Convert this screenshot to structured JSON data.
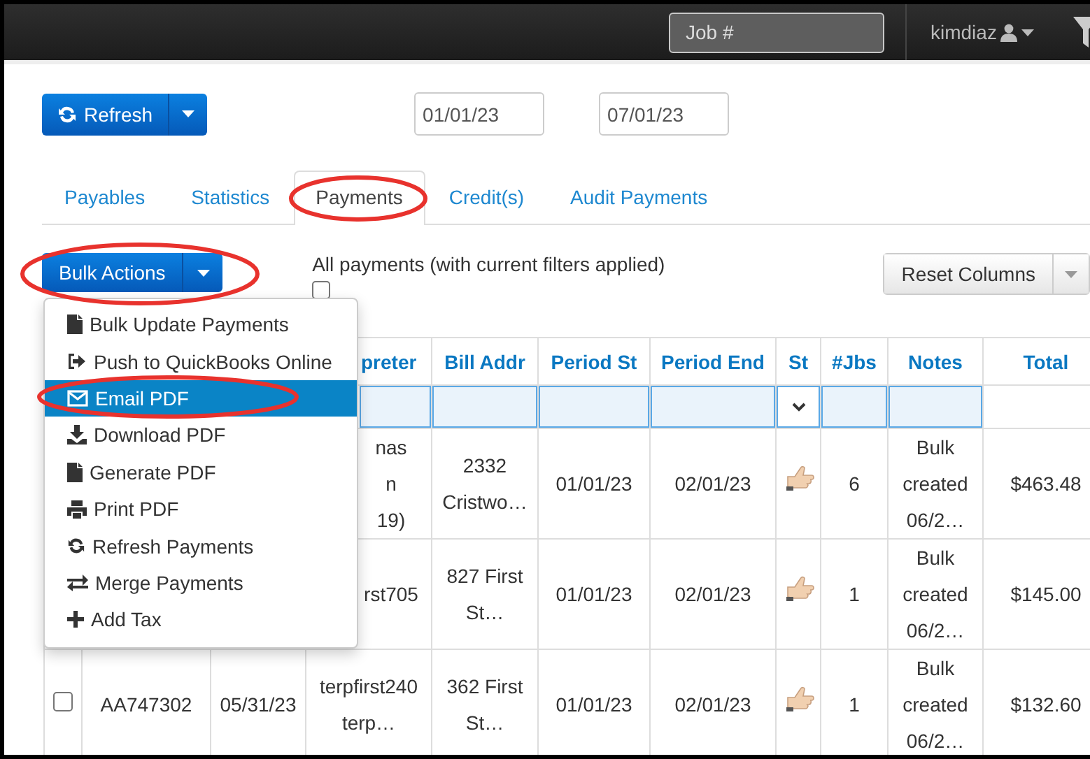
{
  "navbar": {
    "search": {
      "placeholder": "Job #"
    },
    "user": "kimdiaz"
  },
  "toolbar": {
    "refresh_button": "Refresh",
    "date_from": "01/01/23",
    "date_to": "07/01/23"
  },
  "tabs": [
    {
      "label": "Payables",
      "selected": false
    },
    {
      "label": "Statistics",
      "selected": false
    },
    {
      "label": "Payments",
      "selected": true
    },
    {
      "label": "Credit(s)",
      "selected": false
    },
    {
      "label": "Audit Payments",
      "selected": false
    }
  ],
  "bulk_actions": {
    "button": "Bulk Actions",
    "select_all_label": "All payments (with current filters applied)",
    "select_all_checked": false,
    "menu": [
      {
        "label": "Bulk Update Payments",
        "selected": false
      },
      {
        "label": "Push to QuickBooks Online",
        "selected": false
      },
      {
        "label": "Email PDF",
        "selected": true
      },
      {
        "label": "Download PDF",
        "selected": false
      },
      {
        "label": "Generate PDF",
        "selected": false
      },
      {
        "label": "Print PDF",
        "selected": false
      },
      {
        "label": "Refresh Payments",
        "selected": false
      },
      {
        "label": "Merge Payments",
        "selected": false
      },
      {
        "label": "Add Tax",
        "selected": false
      }
    ]
  },
  "reset_columns_button": "Reset Columns",
  "table": {
    "columns": [
      {
        "label": "preter",
        "kind": "input"
      },
      {
        "label": "Bill Addr",
        "kind": "input"
      },
      {
        "label": "Period St",
        "kind": "input"
      },
      {
        "label": "Period End",
        "kind": "input"
      },
      {
        "label": "St",
        "kind": "select"
      },
      {
        "label": "#Jbs",
        "kind": "input"
      },
      {
        "label": "Notes",
        "kind": "input"
      },
      {
        "label": "Total",
        "kind": "plain"
      }
    ],
    "rows": [
      {
        "cells": [
          {
            "kind": "text",
            "text": "nas\nn\n19)"
          },
          {
            "kind": "text",
            "text": "2332 Cristwo…"
          },
          {
            "kind": "text",
            "text": "01/01/23"
          },
          {
            "kind": "text",
            "text": "02/01/23"
          },
          {
            "kind": "icon"
          },
          {
            "kind": "text",
            "text": "6"
          },
          {
            "kind": "text",
            "text": "Bulk created 06/2…"
          },
          {
            "kind": "text",
            "text": "$463.48"
          }
        ]
      },
      {
        "cells": [
          {
            "kind": "text",
            "text": "rst705"
          },
          {
            "kind": "text",
            "text": "827 First St…"
          },
          {
            "kind": "text",
            "text": "01/01/23"
          },
          {
            "kind": "text",
            "text": "02/01/23"
          },
          {
            "kind": "icon"
          },
          {
            "kind": "text",
            "text": "1"
          },
          {
            "kind": "text",
            "text": "Bulk created 06/2…"
          },
          {
            "kind": "text",
            "text": "$145.00"
          }
        ]
      },
      {
        "checked": false,
        "leading": [
          "AA747302",
          "05/31/23"
        ],
        "cells": [
          {
            "kind": "text",
            "text": "terpfirst240 terp…"
          },
          {
            "kind": "text",
            "text": "362 First St…"
          },
          {
            "kind": "text",
            "text": "01/01/23"
          },
          {
            "kind": "text",
            "text": "02/01/23"
          },
          {
            "kind": "icon"
          },
          {
            "kind": "text",
            "text": "1"
          },
          {
            "kind": "text",
            "text": "Bulk created 06/2…"
          },
          {
            "kind": "text",
            "text": "$132.60"
          }
        ]
      }
    ]
  }
}
